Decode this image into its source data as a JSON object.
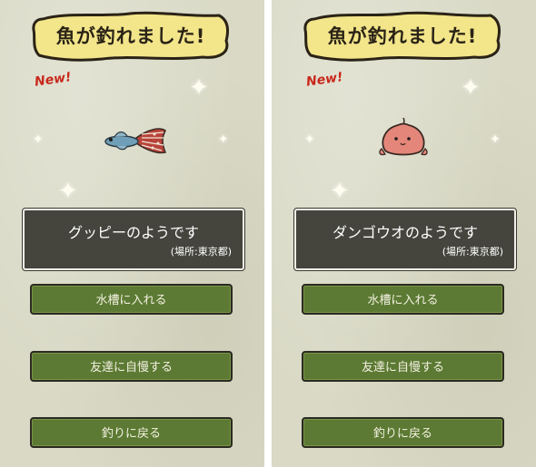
{
  "screens": [
    {
      "title": "魚が釣れました!",
      "badge": "New!",
      "fish_icon": "guppy-fish-icon",
      "fish_name": "グッピーのようです",
      "location": "(場所:東京都)",
      "buttons": {
        "put_in_tank": "水槽に入れる",
        "brag_to_friends": "友達に自慢する",
        "back_to_fishing": "釣りに戻る"
      }
    },
    {
      "title": "魚が釣れました!",
      "badge": "New!",
      "fish_icon": "dango-uo-fish-icon",
      "fish_name": "ダンゴウオのようです",
      "location": "(場所:東京都)",
      "buttons": {
        "put_in_tank": "水槽に入れる",
        "brag_to_friends": "友達に自慢する",
        "back_to_fishing": "釣りに戻る"
      }
    }
  ],
  "colors": {
    "background": "#d9d9c6",
    "title_banner": "#f3e58a",
    "badge_red": "#c8281b",
    "info_box": "#45453e",
    "button_green": "#5c7a33"
  }
}
